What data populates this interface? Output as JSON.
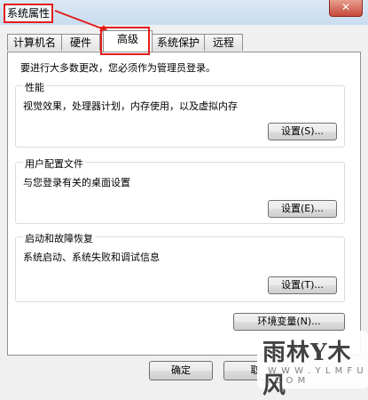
{
  "window": {
    "title": "系统属性",
    "close_label": "✕"
  },
  "tabs": [
    {
      "label": "计算机名"
    },
    {
      "label": "硬件"
    },
    {
      "label": "高级"
    },
    {
      "label": "系统保护"
    },
    {
      "label": "远程"
    }
  ],
  "notice": "要进行大多数更改，您必须作为管理员登录。",
  "groups": {
    "performance": {
      "title": "性能",
      "description": "视觉效果，处理器计划，内存使用，以及虚拟内存",
      "button": "设置(S)..."
    },
    "profiles": {
      "title": "用户配置文件",
      "description": "与您登录有关的桌面设置",
      "button": "设置(E)..."
    },
    "startup": {
      "title": "启动和故障恢复",
      "description": "系统启动、系统失败和调试信息",
      "button": "设置(T)..."
    }
  },
  "env_button": "环境变量(N)...",
  "footer": {
    "ok": "确定",
    "cancel": "取"
  },
  "watermark": {
    "main": "雨林Y木风",
    "sub": "W W W . Y L M F U . C O M"
  },
  "colors": {
    "highlight": "#e31d1d",
    "titlebar": "#c9dcef"
  }
}
